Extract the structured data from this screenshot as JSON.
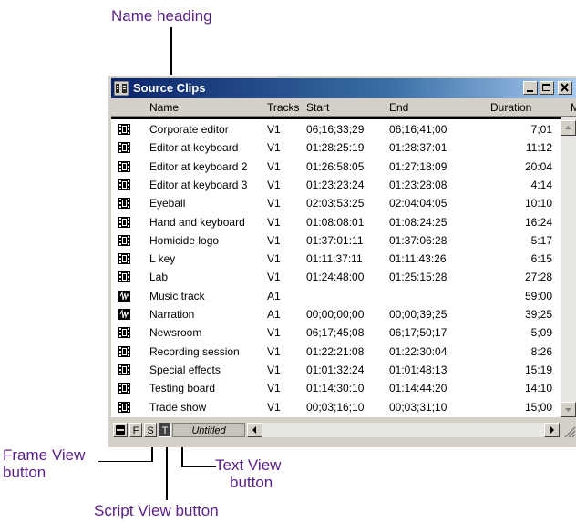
{
  "callouts": {
    "name_heading": "Name heading",
    "frame_view": [
      "Frame View",
      "button"
    ],
    "text_view": [
      "Text View",
      "button"
    ],
    "script_view": "Script View button"
  },
  "window": {
    "title": "Source Clips",
    "controls": [
      "minimize",
      "maximize",
      "close"
    ]
  },
  "columns": [
    "Name",
    "Tracks",
    "Start",
    "End",
    "Duration",
    "M"
  ],
  "rows": [
    {
      "icon": "video-clip-icon",
      "name": "Corporate editor",
      "tracks": "V1",
      "start": "06;16;33;29",
      "end": "06;16;41;00",
      "duration": "7;01"
    },
    {
      "icon": "video-clip-icon",
      "name": "Editor at keyboard",
      "tracks": "V1",
      "start": "01:28:25:19",
      "end": "01:28:37:01",
      "duration": "11:12"
    },
    {
      "icon": "video-clip-icon",
      "name": "Editor at keyboard 2",
      "tracks": "V1",
      "start": "01:26:58:05",
      "end": "01:27:18:09",
      "duration": "20:04"
    },
    {
      "icon": "video-clip-icon",
      "name": "Editor at keyboard 3",
      "tracks": "V1",
      "start": "01:23:23:24",
      "end": "01:23:28:08",
      "duration": "4:14"
    },
    {
      "icon": "video-clip-icon",
      "name": "Eyeball",
      "tracks": "V1",
      "start": "02:03:53:25",
      "end": "02:04:04:05",
      "duration": "10:10"
    },
    {
      "icon": "video-clip-icon",
      "name": "Hand and keyboard",
      "tracks": "V1",
      "start": "01:08:08:01",
      "end": "01:08:24:25",
      "duration": "16:24"
    },
    {
      "icon": "video-clip-icon",
      "name": "Homicide logo",
      "tracks": "V1",
      "start": "01:37:01:11",
      "end": "01:37:06:28",
      "duration": "5:17"
    },
    {
      "icon": "video-clip-icon",
      "name": "L key",
      "tracks": "V1",
      "start": "01:11:37:11",
      "end": "01:11:43:26",
      "duration": "6:15"
    },
    {
      "icon": "video-clip-icon",
      "name": "Lab",
      "tracks": "V1",
      "start": "01:24:48:00",
      "end": "01:25:15:28",
      "duration": "27:28"
    },
    {
      "icon": "audio-clip-icon",
      "name": "Music track",
      "tracks": "A1",
      "start": "",
      "end": "",
      "duration": "59:00"
    },
    {
      "icon": "audio-clip-icon",
      "name": "Narration",
      "tracks": "A1",
      "start": "00;00;00;00",
      "end": "00;00;39;25",
      "duration": "39;25"
    },
    {
      "icon": "video-clip-icon",
      "name": "Newsroom",
      "tracks": "V1",
      "start": "06;17;45;08",
      "end": "06;17;50;17",
      "duration": "5;09"
    },
    {
      "icon": "video-clip-icon",
      "name": "Recording session",
      "tracks": "V1",
      "start": "01:22:21:08",
      "end": "01:22:30:04",
      "duration": "8:26"
    },
    {
      "icon": "video-clip-icon",
      "name": "Special effects",
      "tracks": "V1",
      "start": "01:01:32:24",
      "end": "01:01:48:13",
      "duration": "15:19"
    },
    {
      "icon": "video-clip-icon",
      "name": "Testing board",
      "tracks": "V1",
      "start": "01:14:30:10",
      "end": "01:14:44:20",
      "duration": "14:10"
    },
    {
      "icon": "video-clip-icon",
      "name": "Trade show",
      "tracks": "V1",
      "start": "00;03;16;10",
      "end": "00;03;31;10",
      "duration": "15;00"
    }
  ],
  "bottom_bar": {
    "frame_label": "F",
    "script_label": "S",
    "text_label": "T",
    "untitled": "Untitled"
  },
  "colors": {
    "callout": "#5b1f8a",
    "titlebar_start": "#0a246a",
    "titlebar_end": "#a6caf0"
  }
}
